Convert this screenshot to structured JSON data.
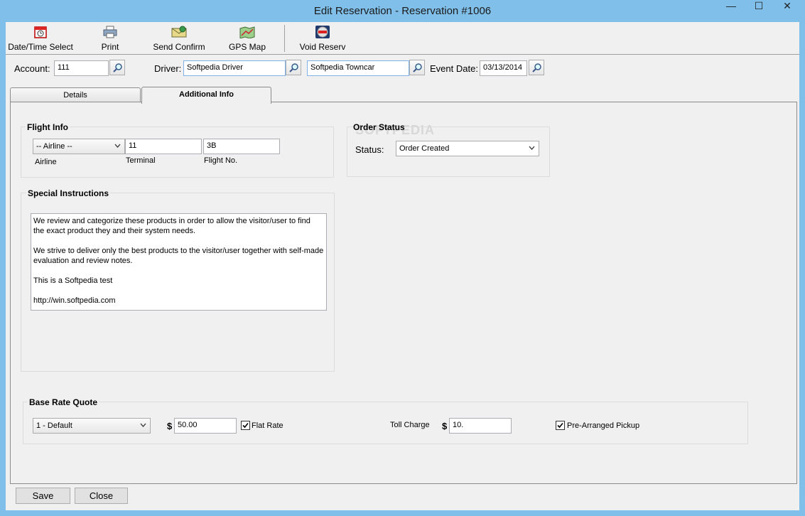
{
  "window": {
    "title": "Edit Reservation - Reservation #1006",
    "controls": {
      "minimize": "—",
      "maximize": "☐",
      "close": "✕"
    }
  },
  "toolbar": {
    "items": [
      {
        "label": "Date/Time Select",
        "icon": "calendar-icon"
      },
      {
        "label": "Print",
        "icon": "printer-icon"
      },
      {
        "label": "Send Confirm",
        "icon": "envelope-icon"
      },
      {
        "label": "GPS Map",
        "icon": "map-icon"
      },
      {
        "label": "Void Reserv",
        "icon": "no-entry-icon"
      }
    ]
  },
  "header": {
    "account_label": "Account:",
    "account_value": "111",
    "driver_label": "Driver:",
    "driver_value": "Softpedia Driver",
    "vehicle_value": "Softpedia Towncar",
    "event_date_label": "Event Date:",
    "event_date_value": "03/13/2014"
  },
  "tabs": [
    {
      "label": "Details",
      "active": false
    },
    {
      "label": "Additional Info",
      "active": true
    }
  ],
  "flight_info": {
    "title": "Flight Info",
    "airline_value": "-- Airline --",
    "airline_label": "Airline",
    "terminal_value": "11",
    "terminal_label": "Terminal",
    "flight_no_value": "3B",
    "flight_no_label": "Flight No."
  },
  "order_status": {
    "title": "Order Status",
    "watermark": "SOFTPEDIA",
    "status_label": "Status:",
    "status_value": "Order Created"
  },
  "special_instructions": {
    "title": "Special Instructions",
    "text": "We review and categorize these products in order to allow the visitor/user to find\nthe exact product they and their system needs.\n\nWe strive to deliver only the best products to the visitor/user together with self-made\nevaluation and review notes.\n\nThis is a Softpedia test\n\nhttp://win.softpedia.com"
  },
  "base_rate": {
    "title": "Base Rate Quote",
    "rate_value": "1 - Default",
    "currency": "$",
    "amount_value": "50.00",
    "flat_rate_label": "Flat Rate",
    "flat_rate_checked": true,
    "toll_label": "Toll Charge",
    "toll_currency": "$",
    "toll_value": "10.",
    "pre_arranged_label": "Pre-Arranged Pickup",
    "pre_arranged_checked": true
  },
  "footer": {
    "save_label": "Save",
    "close_label": "Close"
  }
}
